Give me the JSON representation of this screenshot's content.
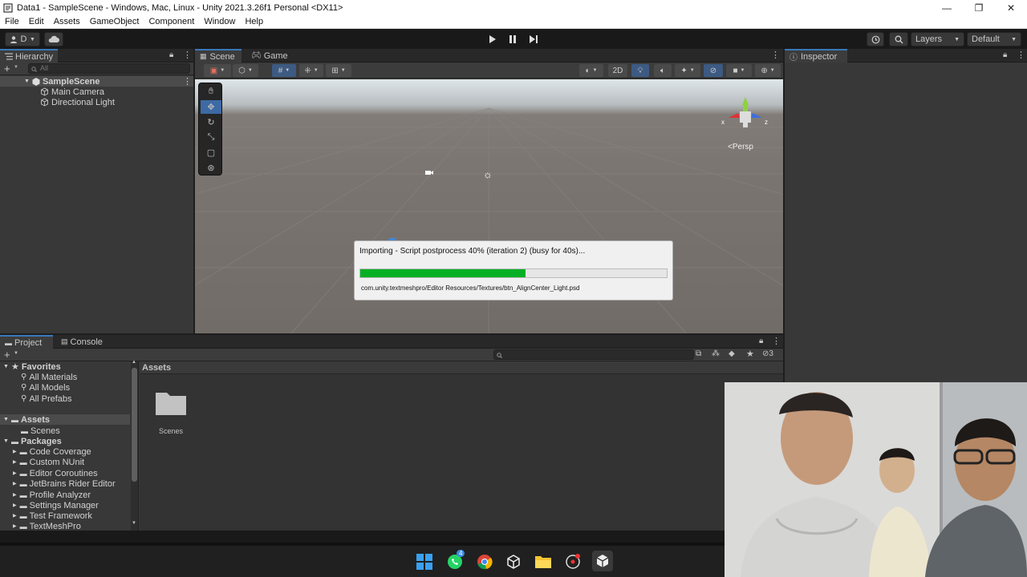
{
  "window": {
    "title": "Data1 - SampleScene - Windows, Mac, Linux - Unity 2021.3.26f1 Personal <DX11>",
    "minimize": "—",
    "maximize": "❐",
    "close": "✕"
  },
  "menu": [
    "File",
    "Edit",
    "Assets",
    "GameObject",
    "Component",
    "Window",
    "Help"
  ],
  "toolbar": {
    "account_label": "D",
    "layers_label": "Layers",
    "layout_label": "Default"
  },
  "hierarchy": {
    "tab_label": "Hierarchy",
    "search_placeholder": "All",
    "scene_name": "SampleScene",
    "items": [
      "Main Camera",
      "Directional Light"
    ]
  },
  "scene": {
    "tabs": [
      "Scene",
      "Game"
    ],
    "mode_2d": "2D",
    "persp_label": "Persp",
    "axis_x": "x",
    "axis_z": "z"
  },
  "import_dialog": {
    "message": "Importing - Script postprocess 40% (iteration 2) (busy for 40s)...",
    "progress": 0.54,
    "path": "com.unity.textmeshpro/Editor Resources/Textures/btn_AlignCenter_Light.psd"
  },
  "inspector": {
    "tab_label": "Inspector"
  },
  "project": {
    "tabs": [
      "Project",
      "Console"
    ],
    "favorites_label": "Favorites",
    "favorites": [
      "All Materials",
      "All Models",
      "All Prefabs"
    ],
    "assets_label": "Assets",
    "assets_children": [
      "Scenes"
    ],
    "packages_label": "Packages",
    "packages": [
      "Code Coverage",
      "Custom NUnit",
      "Editor Coroutines",
      "JetBrains Rider Editor",
      "Profile Analyzer",
      "Settings Manager",
      "Test Framework",
      "TextMeshPro"
    ],
    "breadcrumb": "Assets",
    "grid_items": [
      "Scenes"
    ],
    "hidden_count": "3"
  },
  "taskbar": {
    "whatsapp_badge": "4"
  },
  "colors": {
    "accent": "#3a79bb",
    "progress_fill": "#06b025",
    "panel_bg": "#383838"
  }
}
